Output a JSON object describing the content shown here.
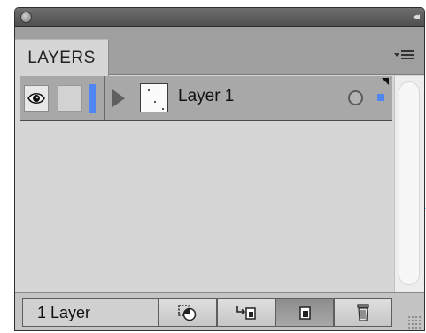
{
  "panel": {
    "tab_label": "LAYERS",
    "close_icon": "circle-close-icon",
    "collapse_icon": "double-chevron-left-icon",
    "collapse_glyph": "◂◂",
    "menu_icon": "panel-menu-icon"
  },
  "layers": [
    {
      "name": "Layer 1",
      "visible": true,
      "locked": false,
      "color": "#4f86f2",
      "expanded": false
    }
  ],
  "footer": {
    "count_label": "1 Layer",
    "buttons": [
      {
        "name": "make-clipping-mask-icon"
      },
      {
        "name": "create-sublayer-icon"
      },
      {
        "name": "create-new-layer-icon"
      },
      {
        "name": "delete-layer-icon"
      }
    ]
  },
  "colors": {
    "titlebar": "#5a5a5a",
    "panel_bg": "#d6d6d6",
    "selected_row": "#a8a8a8",
    "layer_color": "#4f86f2",
    "guide_line": "#7fe0ee"
  }
}
